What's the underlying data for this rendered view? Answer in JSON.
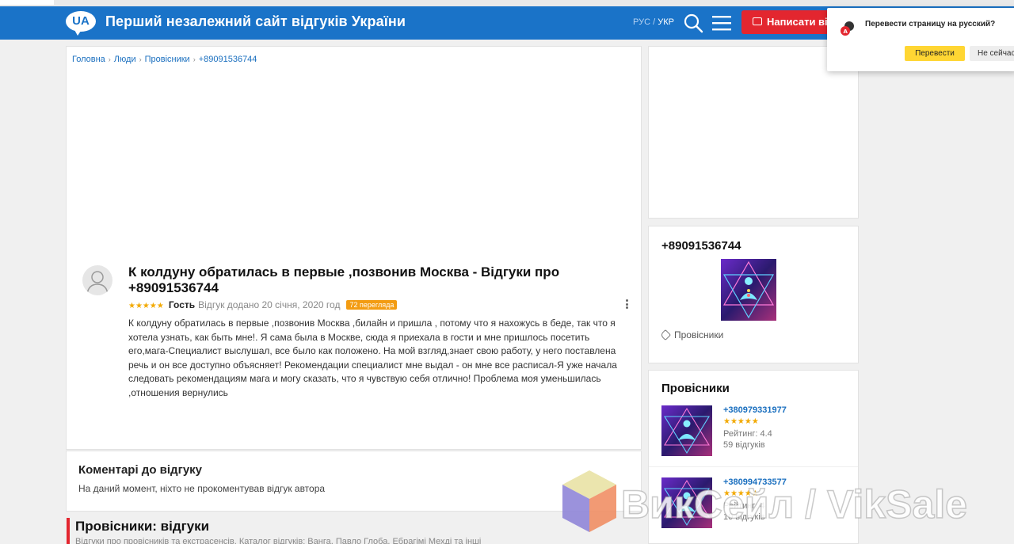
{
  "header": {
    "logo_text": "UA",
    "site_title": "Перший незалежний сайт відгуків України",
    "lang_ru": "РУС",
    "lang_sep": " / ",
    "lang_ua": "УКР",
    "write_button": "Написати від"
  },
  "breadcrumbs": [
    "Головна",
    "Люди",
    "Провісники",
    "+89091536744"
  ],
  "review": {
    "title": "К колдуну обратилась в первые ,позвонив Москва - Відгуки про +89091536744",
    "stars": "★★★★★",
    "author": "Гость",
    "date": "Відгук додано 20 січня, 2020 год",
    "views": "72 перегляда",
    "body": "К колдуну обратилась в первые ,позвонив Москва ,билайн и пришла , потому что я нахожусь в беде, так что я хотела узнать, как быть мне!. Я сама была в Москве, сюда я приехала в гости и мне пришлось посетить его,мага-Специалист выслушал, все было как положено. На мой взгляд,знает свою работу, у него поставлена речь и он все доступно объясняет! Рекомендации специалист мне выдал - он мне все расписал-Я уже начала следовать рекомендациям мага и могу сказать, что я чувствую себя отлично! Проблема моя уменьшилась ,отношения вернулись"
  },
  "comments": {
    "title": "Коментарі до відгуку",
    "empty": "На даний момент, ніхто не прокоментував відгук автора"
  },
  "section": {
    "title": "Провісники: відгуки",
    "subtitle": "Відгуки про провісників та екстрасенсів. Каталог відгуків: Ванга, Павло Глоба, Ебрагімі Мехді та інші"
  },
  "sidebar": {
    "phone_card": {
      "phone": "+89091536744",
      "tag": "Провісники"
    },
    "list": {
      "title": "Провісники",
      "items": [
        {
          "phone": "+380979331977",
          "stars": "★★★★★",
          "rating": "Рейтинг: 4.4",
          "reviews": "59 відгуків"
        },
        {
          "phone": "+380994733577",
          "stars": "★★★★★",
          "rating": "Рейтинг: 4",
          "reviews": "10 відгуків"
        }
      ]
    }
  },
  "translate_popup": {
    "question": "Перевести страницу на русский?",
    "translate": "Перевести",
    "not_now": "Не сейчас"
  },
  "watermark": {
    "text": "ВикСейл / VikSale"
  },
  "colors": {
    "brand_blue": "#1a73c8",
    "accent_red": "#e3262f",
    "star": "#f2a900",
    "link": "#1a6fbf"
  }
}
